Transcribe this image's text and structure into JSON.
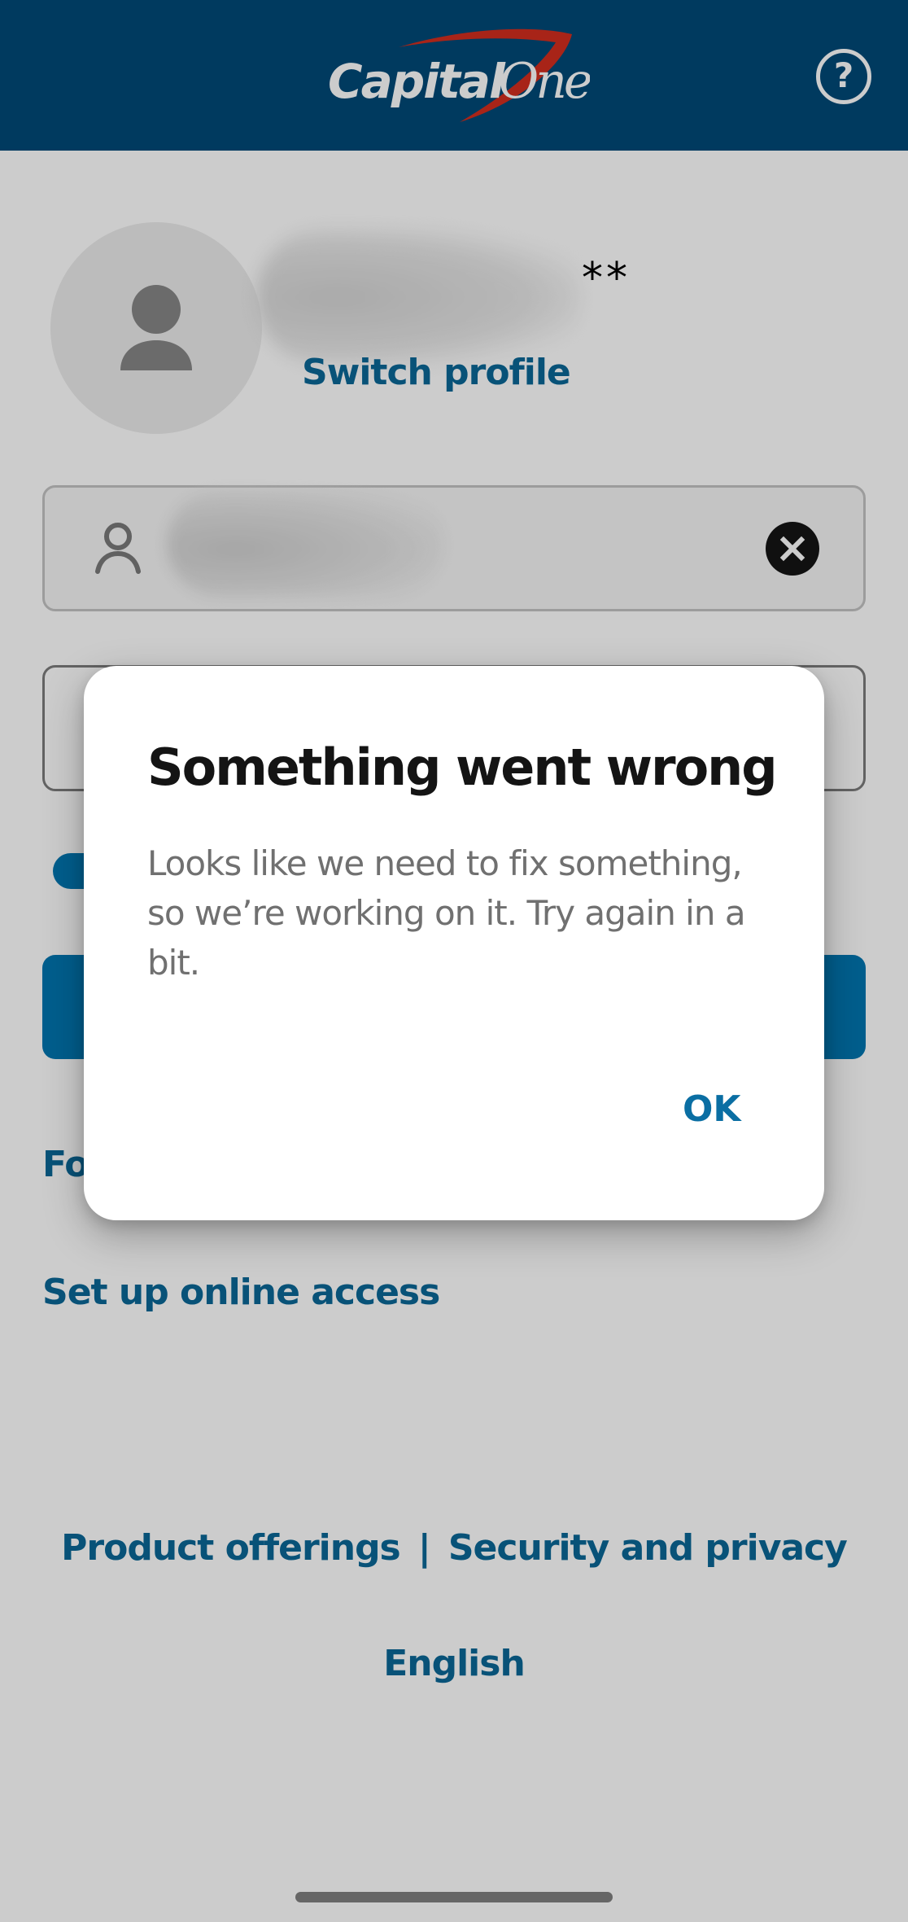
{
  "header": {
    "logo_text_primary": "Capital",
    "logo_text_secondary": "One",
    "help_icon": "help-circle-icon",
    "help_glyph": "?"
  },
  "profile": {
    "avatar_icon": "person-icon",
    "name_masked_suffix": "**",
    "switch_profile_label": "Switch profile"
  },
  "login_form": {
    "username_icon": "person-outline-icon",
    "username_value_redacted": true,
    "clear_icon": "clear-circle-icon",
    "password_value": ""
  },
  "links": {
    "forgot_partial": "Fo",
    "setup_online_access": "Set up online access",
    "product_offerings": "Product offerings",
    "separator": "|",
    "security_and_privacy": "Security and privacy",
    "language": "English"
  },
  "dialog": {
    "title": "Something went wrong",
    "body": "Looks like we need to fix something, so we’re working on it. Try again in a bit.",
    "ok_label": "OK"
  },
  "colors": {
    "header_bg": "#004977",
    "brand_red": "#d22e1e",
    "link_blue": "#0a6796",
    "primary_button": "#0276b1",
    "dialog_title": "#141414",
    "dialog_body": "#707070"
  }
}
